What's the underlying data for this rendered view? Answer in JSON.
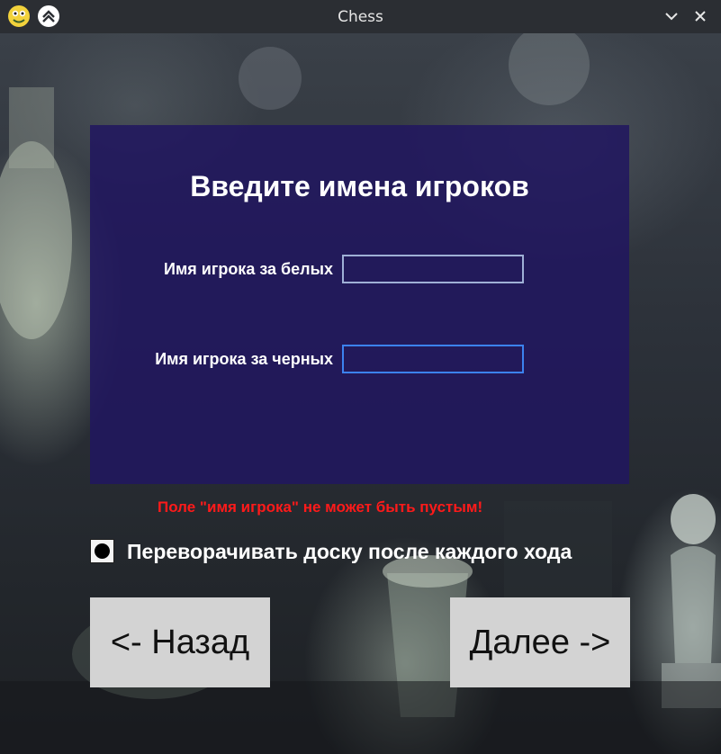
{
  "window": {
    "title": "Chess"
  },
  "dialog": {
    "heading": "Введите имена игроков",
    "white_label": "Имя игрока за белых",
    "white_value": "",
    "black_label": "Имя игрока за черных",
    "black_value": ""
  },
  "error": {
    "message": "Поле \"имя игрока\" не может быть пустым!",
    "color": "#ff1a1a"
  },
  "options": {
    "flip_board_label": "Переворачивать доску после каждого хода",
    "flip_board_checked": true
  },
  "buttons": {
    "back_label": "<- Назад",
    "next_label": "Далее ->"
  },
  "colors": {
    "panel": "#211660",
    "active_input_border": "#3c82f0",
    "button_bg": "#d3d3d3"
  }
}
